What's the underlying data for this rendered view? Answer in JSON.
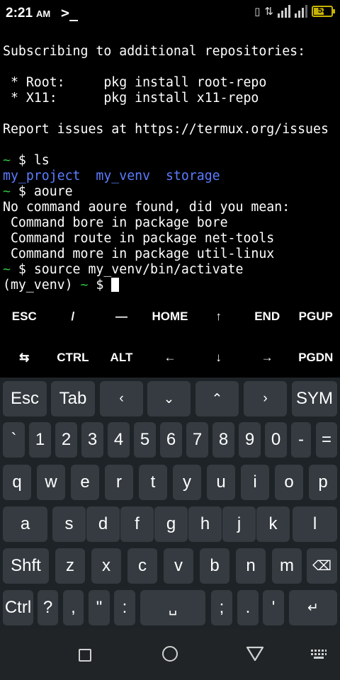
{
  "status_bar": {
    "time": "2:21",
    "ampm": "AM",
    "app_prompt": ">_",
    "battery": "53",
    "icons": [
      "vibrate-icon",
      "data-arrows-icon",
      "signal-icon",
      "signal-icon",
      "battery-icon"
    ]
  },
  "terminal": {
    "line1": "Subscribing to additional repositories:",
    "line2_label": " * Root:     ",
    "line2_cmd": "pkg install root-repo",
    "line3_label": " * X11:      ",
    "line3_cmd": "pkg install x11-repo",
    "line4": "Report issues at https://termux.org/issues",
    "prompt_symbol": "~",
    "prompt_dollar": " $ ",
    "cmd1": "ls",
    "ls_out": [
      "my_project",
      "my_venv",
      "storage"
    ],
    "cmd2": "aoure",
    "err1": "No command aoure found, did you mean:",
    "err2": " Command bore in package bore",
    "err3": " Command route in package net-tools",
    "err4": " Command more in package util-linux",
    "cmd3": "source my_venv/bin/activate",
    "venv_prefix": "(my_venv) "
  },
  "extra_keys": {
    "row1": [
      "ESC",
      "/",
      "—",
      "HOME",
      "↑",
      "END",
      "PGUP"
    ],
    "row2": [
      "⇆",
      "CTRL",
      "ALT",
      "←",
      "↓",
      "→",
      "PGDN"
    ]
  },
  "keyboard": {
    "row1": [
      "Esc",
      "Tab",
      "‹",
      "⌄",
      "⌃",
      "›",
      "SYM"
    ],
    "row2": [
      "`",
      "1",
      "2",
      "3",
      "4",
      "5",
      "6",
      "7",
      "8",
      "9",
      "0",
      "-",
      "="
    ],
    "row3": [
      "q",
      "w",
      "e",
      "r",
      "t",
      "y",
      "u",
      "i",
      "o",
      "p"
    ],
    "row4": [
      "a",
      "s",
      "d",
      "f",
      "g",
      "h",
      "j",
      "k",
      "l"
    ],
    "row5": [
      "Shft",
      "z",
      "x",
      "c",
      "v",
      "b",
      "n",
      "m",
      "⌫"
    ],
    "row6": [
      "Ctrl",
      "?",
      ",",
      "\"",
      ":",
      "␣",
      ";",
      ".",
      "'",
      "↵"
    ]
  },
  "colors": {
    "prompt_green": "#2ec840",
    "dir_blue": "#5b7dff",
    "keyboard_bg": "#1e2327",
    "key_bg": "#353b41"
  }
}
